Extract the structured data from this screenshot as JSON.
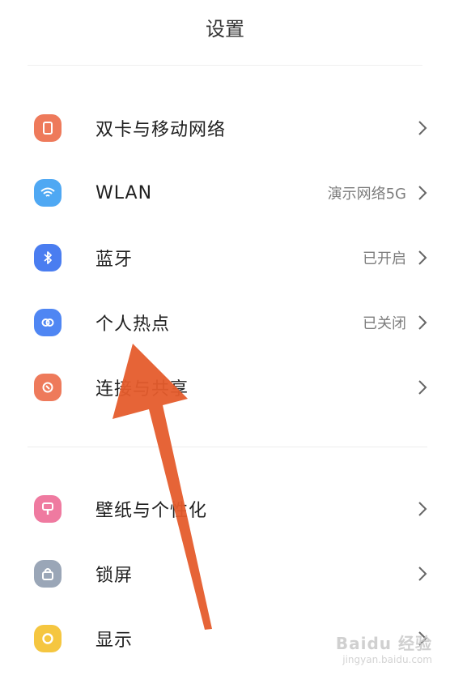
{
  "header": {
    "title": "设置"
  },
  "colors": {
    "sim": "#ee7a5b",
    "wlan": "#4fa8f3",
    "bluetooth": "#4a7df0",
    "hotspot": "#4f86f3",
    "connection": "#ee7a5b",
    "wallpaper": "#ef7aa0",
    "lockscreen": "#9aa6b7",
    "display": "#f5c640",
    "arrow": "#e55c2c"
  },
  "section1": [
    {
      "label": "双卡与移动网络",
      "value": "",
      "icon": "sim-card-icon"
    },
    {
      "label": "WLAN",
      "value": "演示网络5G",
      "icon": "wifi-icon"
    },
    {
      "label": "蓝牙",
      "value": "已开启",
      "icon": "bluetooth-icon"
    },
    {
      "label": "个人热点",
      "value": "已关闭",
      "icon": "hotspot-icon"
    },
    {
      "label": "连接与共享",
      "value": "",
      "icon": "connection-share-icon"
    }
  ],
  "section2": [
    {
      "label": "壁纸与个性化",
      "value": "",
      "icon": "wallpaper-icon"
    },
    {
      "label": "锁屏",
      "value": "",
      "icon": "lock-icon"
    },
    {
      "label": "显示",
      "value": "",
      "icon": "display-icon"
    }
  ],
  "watermark": {
    "brand": "Baidu 经验",
    "url": "jingyan.baidu.com"
  }
}
